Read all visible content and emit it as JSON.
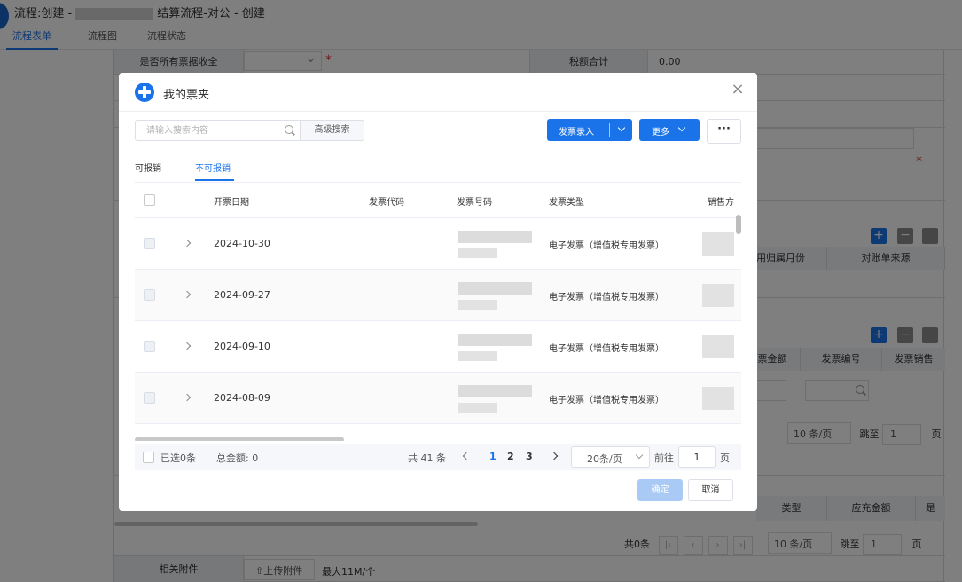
{
  "page": {
    "title_prefix": "流程:创建 -",
    "title_suffix": "结算流程-对公 - 创建",
    "tabs": [
      "流程表单",
      "流程图",
      "流程状态"
    ]
  },
  "background_form": {
    "row1_label": "是否所有票据收全",
    "row1_required": "*",
    "tax_label": "税额合计",
    "tax_value": "0.00",
    "row4_required": "*",
    "table1_headers": [
      "用归属月份",
      "对账单来源"
    ],
    "table2_headers": [
      "发票金额",
      "发票编号",
      "发票销售"
    ],
    "pager1": {
      "size": "10 条/页",
      "goto": "跳至",
      "page": "1",
      "unit": "页"
    },
    "table3_headers": [
      "类型",
      "应充金额",
      "是"
    ],
    "pager2": {
      "count": "共0条",
      "size": "10 条/页",
      "goto": "跳至",
      "page": "1",
      "unit": "页"
    },
    "attach_label": "相关附件",
    "upload_label": "上传附件",
    "attach_hint": "最大11M/个",
    "icons": {
      "add": "+",
      "remove": "−"
    }
  },
  "modal": {
    "title": "我的票夹",
    "search": {
      "placeholder": "请输入搜索内容",
      "advanced_label": "高级搜索"
    },
    "buttons": {
      "entry": "发票录入",
      "more": "更多",
      "dots": "···",
      "ok": "确定",
      "cancel": "取消"
    },
    "tabs": {
      "reimbursable": "可报销",
      "not_reimbursable": "不可报销"
    },
    "table": {
      "headers": {
        "date": "开票日期",
        "code": "发票代码",
        "number": "发票号码",
        "type": "发票类型",
        "seller": "销售方"
      },
      "rows": [
        {
          "date": "2024-10-30",
          "type": "电子发票（增值税专用发票）"
        },
        {
          "date": "2024-09-27",
          "type": "电子发票（增值税专用发票）"
        },
        {
          "date": "2024-09-10",
          "type": "电子发票（增值税专用发票）"
        },
        {
          "date": "2024-08-09",
          "type": "电子发票（增值税专用发票）"
        }
      ]
    },
    "footer": {
      "selected": "已选0条",
      "total": "总金额: 0",
      "count": "共 41 条",
      "pages": [
        "1",
        "2",
        "3"
      ],
      "current_page": "1",
      "page_size": "20条/页",
      "goto_label": "前往",
      "goto_value": "1",
      "page_unit": "页"
    }
  },
  "colors": {
    "accent": "#1a73e8",
    "ok_disabled": "#a8caf5",
    "mask": "rgba(0,0,0,0.5)"
  }
}
